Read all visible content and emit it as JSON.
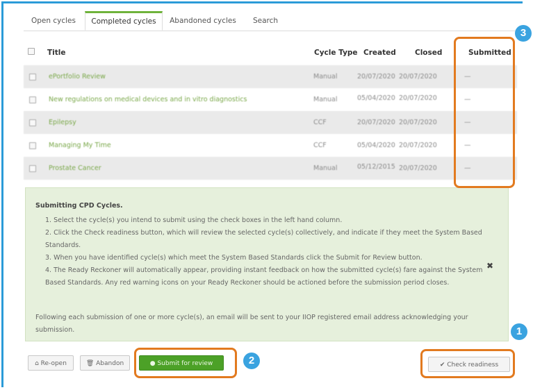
{
  "tabs": [
    {
      "label": "Open cycles",
      "active": false
    },
    {
      "label": "Completed cycles",
      "active": true
    },
    {
      "label": "Abandoned cycles",
      "active": false
    },
    {
      "label": "Search",
      "active": false
    }
  ],
  "table": {
    "headers": {
      "title": "Title",
      "cycle_type": "Cycle Type",
      "created": "Created",
      "closed": "Closed",
      "submitted": "Submitted"
    },
    "rows": [
      {
        "title": "ePortfolio Review",
        "type": "Manual",
        "created": "20/07/2020",
        "closed": "20/07/2020",
        "submitted": "—"
      },
      {
        "title": "New regulations on medical devices and in vitro diagnostics",
        "type": "Manual",
        "created": "05/04/2020",
        "closed": "20/07/2020",
        "submitted": "—"
      },
      {
        "title": "Epilepsy",
        "type": "CCF",
        "created": "20/07/2020",
        "closed": "20/07/2020",
        "submitted": "—"
      },
      {
        "title": "Managing My Time",
        "type": "CCF",
        "created": "05/04/2020",
        "closed": "20/07/2020",
        "submitted": "—"
      },
      {
        "title": "Prostate Cancer",
        "type": "Manual",
        "created": "05/12/2015",
        "closed": "20/07/2020",
        "submitted": "—"
      }
    ]
  },
  "info": {
    "heading": "Submitting CPD Cycles.",
    "items": [
      "1. Select the cycle(s) you intend to submit using the check boxes in the left hand column.",
      "2. Click the Check readiness button, which will review the selected cycle(s) collectively, and indicate if they meet the System Based Standards.",
      "3. When you have identified cycle(s) which meet the System Based Standards click the Submit for Review button.",
      "4. The Ready Reckoner will automatically appear, providing instant feedback on how the submitted cycle(s) fare against the System Based Standards. Any red warning icons on your Ready Reckoner should be actioned before the submission period closes."
    ],
    "footer": "Following each submission of one or more cycle(s), an email will be sent to your IIOP registered email address acknowledging your submission.",
    "close_glyph": "✖"
  },
  "buttons": {
    "reopen": "Re-open",
    "abandon": "Abandon",
    "submit": "Submit for review",
    "check": "✔ Check readiness"
  },
  "badges": {
    "one": "1",
    "two": "2",
    "three": "3"
  },
  "colors": {
    "accent_orange": "#e27a1f",
    "badge_blue": "#3aa3e0",
    "primary_green": "#4ca127",
    "info_bg": "#e6f0dc",
    "frame_blue": "#2b9bd8"
  }
}
